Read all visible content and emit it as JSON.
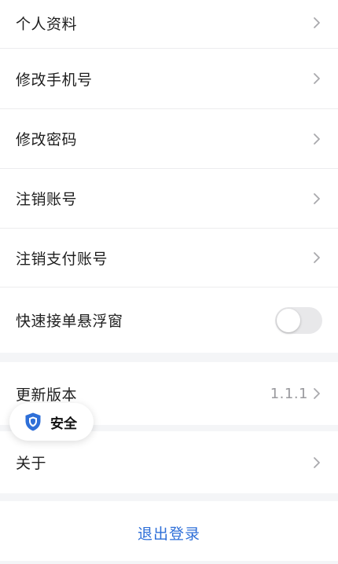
{
  "menu": {
    "profile": "个人资料",
    "change_phone": "修改手机号",
    "change_password": "修改密码",
    "cancel_account": "注销账号",
    "cancel_payment_account": "注销支付账号",
    "float_window": "快速接单悬浮窗",
    "float_window_enabled": false
  },
  "update": {
    "label": "更新版本",
    "version": "1.1.1"
  },
  "about": {
    "label": "关于"
  },
  "security_badge": {
    "label": "安全"
  },
  "logout": {
    "label": "退出登录"
  },
  "colors": {
    "accent": "#2e6fd8",
    "page_background": "#f4f5f7",
    "toggle_off": "#e8e8ea"
  }
}
